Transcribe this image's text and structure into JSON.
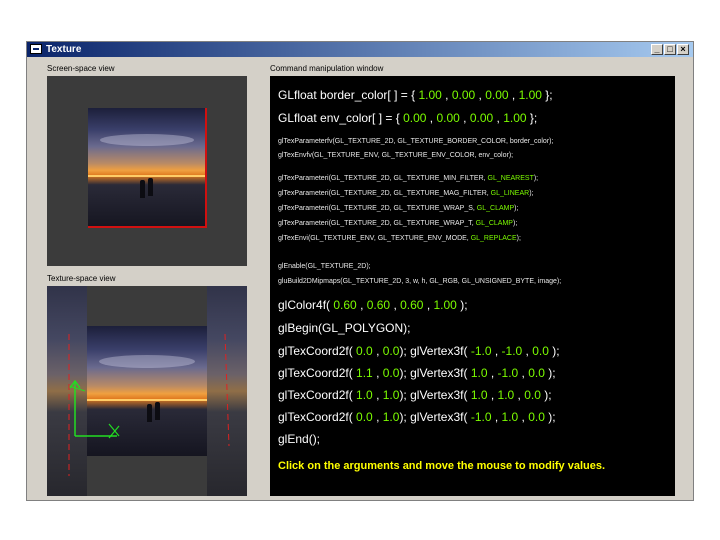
{
  "window": {
    "title": "Texture",
    "buttons": {
      "minimize": "_",
      "maximize": "□",
      "close": "×"
    }
  },
  "panes": {
    "screen_label": "Screen-space view",
    "texture_label": "Texture-space view",
    "command_label": "Command manipulation window"
  },
  "code": {
    "border_color": {
      "prefix": "GLfloat border_color[ ] = {",
      "v": [
        "1.00",
        "0.00",
        "0.00",
        "1.00"
      ],
      "suffix": "};"
    },
    "env_color": {
      "prefix": "GLfloat env_color[ ] = {",
      "v": [
        "0.00",
        "0.00",
        "0.00",
        "1.00"
      ],
      "suffix": "};"
    },
    "param1": "glTexParameterfv(GL_TEXTURE_2D, GL_TEXTURE_BORDER_COLOR, border_color);",
    "param2": "glTexEnvfv(GL_TEXTURE_ENV, GL_TEXTURE_ENV_COLOR, env_color);",
    "minf": {
      "prefix": "glTexParameteri(GL_TEXTURE_2D, GL_TEXTURE_MIN_FILTER,",
      "v": "GL_NEAREST",
      "suffix": ");"
    },
    "magf": {
      "prefix": "glTexParameteri(GL_TEXTURE_2D, GL_TEXTURE_MAG_FILTER,",
      "v": "GL_LINEAR",
      "suffix": ");"
    },
    "wraps": {
      "prefix": "glTexParameteri(GL_TEXTURE_2D, GL_TEXTURE_WRAP_S,",
      "v": "GL_CLAMP",
      "suffix": ");"
    },
    "wrapt": {
      "prefix": "glTexParameteri(GL_TEXTURE_2D, GL_TEXTURE_WRAP_T,",
      "v": "GL_CLAMP",
      "suffix": ");"
    },
    "envmode": {
      "prefix": "glTexEnvi(GL_TEXTURE_ENV, GL_TEXTURE_ENV_MODE,",
      "v": "GL_REPLACE",
      "suffix": ");"
    },
    "enable": "glEnable(GL_TEXTURE_2D);",
    "mipmaps": "gluBuild2DMipmaps(GL_TEXTURE_2D, 3, w, h, GL_RGB, GL_UNSIGNED_BYTE, image);",
    "color4f": {
      "prefix": "glColor4f(",
      "v": [
        "0.60",
        "0.60",
        "0.60",
        "1.00"
      ],
      "suffix": ");"
    },
    "begin": "glBegin(GL_POLYGON);",
    "verts": [
      {
        "tc": [
          "0.0",
          "0.0"
        ],
        "v": [
          "-1.0",
          "-1.0",
          "0.0"
        ]
      },
      {
        "tc": [
          "1.1",
          "0.0"
        ],
        "v": [
          "1.0",
          "-1.0",
          "0.0"
        ]
      },
      {
        "tc": [
          "1.0",
          "1.0"
        ],
        "v": [
          "1.0",
          "1.0",
          "0.0"
        ]
      },
      {
        "tc": [
          "0.0",
          "1.0"
        ],
        "v": [
          "-1.0",
          "1.0",
          "0.0"
        ]
      }
    ],
    "texcoord_fn": "glTexCoord2f(",
    "vertex_fn": "glVertex3f(",
    "end": "glEnd();",
    "hint": "Click on the arguments and move the mouse to modify values."
  },
  "colors": {
    "accent_value": "#7cfc00",
    "hint": "#ffff00",
    "titlebar": "#0a246a"
  }
}
